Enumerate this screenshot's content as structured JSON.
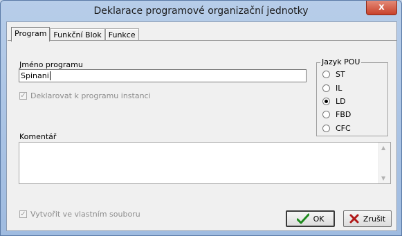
{
  "window": {
    "title": "Deklarace programové organizační jednotky",
    "close_glyph": "x"
  },
  "tabs": [
    {
      "label": "Program",
      "active": true
    },
    {
      "label": "Funkční Blok",
      "active": false
    },
    {
      "label": "Funkce",
      "active": false
    }
  ],
  "program_name": {
    "label": "Jméno programu",
    "value": "Spinani"
  },
  "declare_instance": {
    "label": "Deklarovat k programu instanci",
    "checked": true,
    "enabled": false
  },
  "language_group": {
    "title": "Jazyk POU",
    "options": [
      {
        "label": "ST",
        "selected": false
      },
      {
        "label": "IL",
        "selected": false
      },
      {
        "label": "LD",
        "selected": true
      },
      {
        "label": "FBD",
        "selected": false
      },
      {
        "label": "CFC",
        "selected": false
      }
    ]
  },
  "comment": {
    "label": "Komentář",
    "value": ""
  },
  "own_file": {
    "label": "Vytvořit ve vlastním souboru",
    "checked": true,
    "enabled": false
  },
  "buttons": {
    "ok": {
      "label": "OK",
      "icon": "checkmark-icon",
      "color": "#1d8a1d"
    },
    "cancel": {
      "label": "Zrušit",
      "icon": "cross-icon",
      "color": "#b01818"
    }
  }
}
